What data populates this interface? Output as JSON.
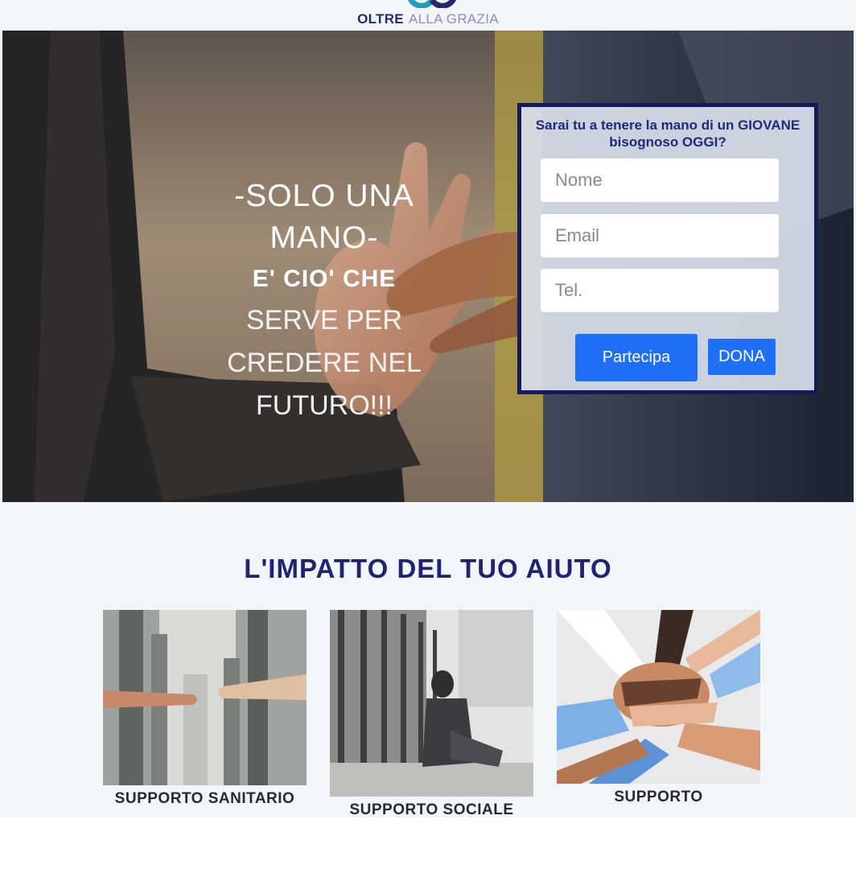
{
  "header": {
    "logo_strong": "OLTRE",
    "logo_light": "ALLA GRAZIA"
  },
  "hero": {
    "line1": "-SOLO UNA MANO-",
    "line2": "E'  CIO' CHE",
    "line3": "SERVE PER CREDERE NEL FUTURO!!!"
  },
  "form": {
    "title": "Sarai tu a tenere la mano di un GIOVANE bisognoso OGGI?",
    "name_placeholder": "Nome",
    "email_placeholder": "Email",
    "tel_placeholder": "Tel.",
    "submit_label": "Partecipa",
    "donate_label": "DONA"
  },
  "impact": {
    "title": "L'IMPATTO DEL TUO AIUTO",
    "cards": [
      {
        "caption": "SUPPORTO SANITARIO"
      },
      {
        "caption": "SUPPORTO SOCIALE"
      },
      {
        "caption": "SUPPORTO"
      }
    ]
  },
  "colors": {
    "brand_navy": "#1f2370",
    "button_blue": "#1e6ff5",
    "section_bg": "#f1f6fb"
  }
}
